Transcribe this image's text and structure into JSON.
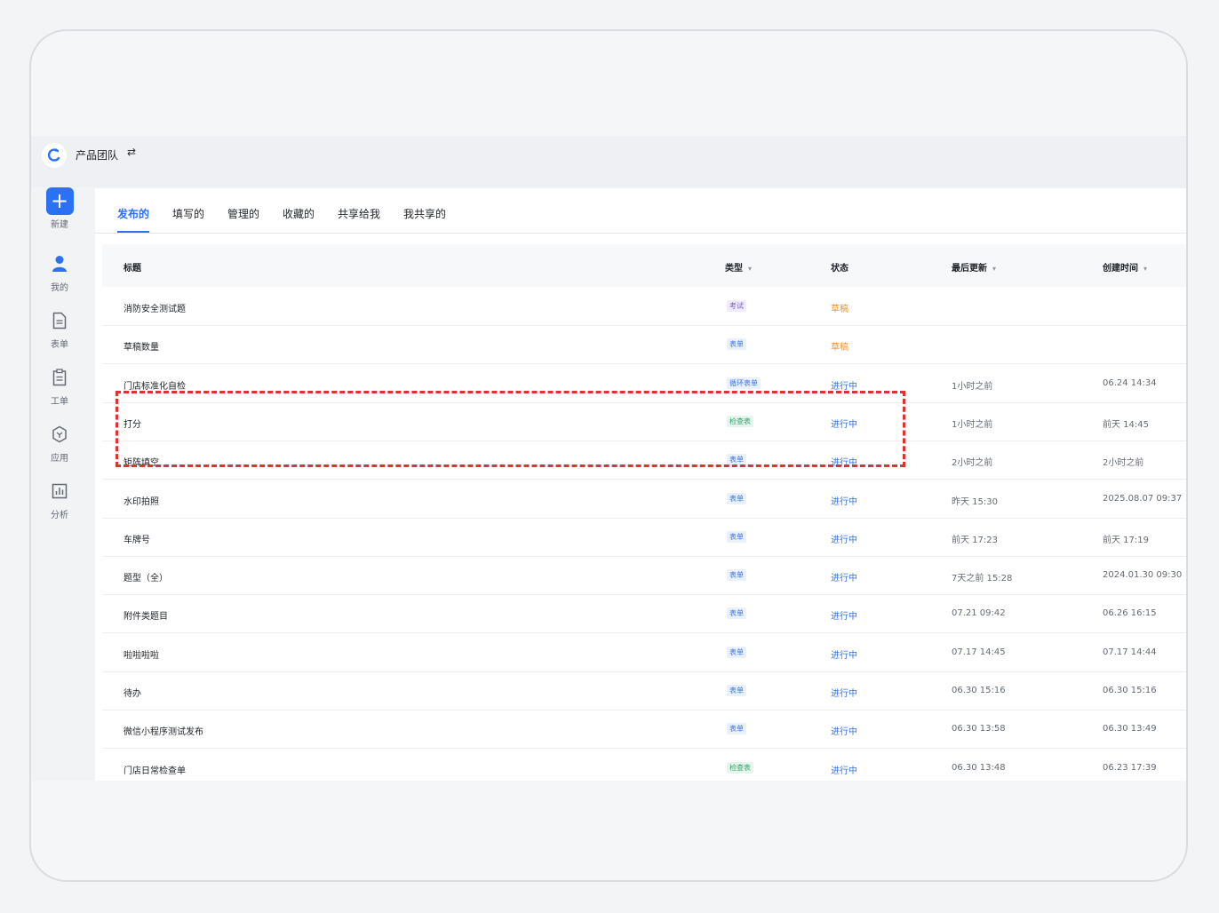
{
  "header": {
    "team_name": "产品团队",
    "switch_icon": "⇄"
  },
  "sidebar": {
    "items": [
      {
        "label": "新建",
        "icon": "plus-icon"
      },
      {
        "label": "我的",
        "icon": "user-icon"
      },
      {
        "label": "表单",
        "icon": "form-icon"
      },
      {
        "label": "工单",
        "icon": "clipboard-icon"
      },
      {
        "label": "应用",
        "icon": "app-icon"
      },
      {
        "label": "分析",
        "icon": "chart-icon"
      }
    ]
  },
  "tabs": [
    {
      "label": "发布的",
      "active": true
    },
    {
      "label": "填写的"
    },
    {
      "label": "管理的"
    },
    {
      "label": "收藏的"
    },
    {
      "label": "共享给我"
    },
    {
      "label": "我共享的"
    }
  ],
  "table": {
    "headers": {
      "title": "标题",
      "type": "类型",
      "status": "状态",
      "updated": "最后更新",
      "created": "创建时间"
    },
    "rows": [
      {
        "title": "消防安全测试题",
        "type": "考试",
        "status": "草稿",
        "updated": "",
        "created": ""
      },
      {
        "title": "草稿数量",
        "type": "表单",
        "status": "草稿",
        "updated": "",
        "created": ""
      },
      {
        "title": "门店标准化自检",
        "type": "循环表单",
        "status": "进行中",
        "updated": "1小时之前",
        "created": "06.24 14:34"
      },
      {
        "title": "打分",
        "type": "检查表",
        "status": "进行中",
        "updated": "1小时之前",
        "created": "前天 14:45"
      },
      {
        "title": "矩阵填空",
        "type": "表单",
        "status": "进行中",
        "updated": "2小时之前",
        "created": "2小时之前"
      },
      {
        "title": "水印拍照",
        "type": "表单",
        "status": "进行中",
        "updated": "昨天 15:30",
        "created": "2025.08.07 09:37"
      },
      {
        "title": "车牌号",
        "type": "表单",
        "status": "进行中",
        "updated": "前天 17:23",
        "created": "前天 17:19"
      },
      {
        "title": "题型（全）",
        "type": "表单",
        "status": "进行中",
        "updated": "7天之前 15:28",
        "created": "2024.01.30 09:30"
      },
      {
        "title": "附件类题目",
        "type": "表单",
        "status": "进行中",
        "updated": "07.21 09:42",
        "created": "06.26 16:15"
      },
      {
        "title": "啦啦啦啦",
        "type": "表单",
        "status": "进行中",
        "updated": "07.17 14:45",
        "created": "07.17 14:44"
      },
      {
        "title": "待办",
        "type": "表单",
        "status": "进行中",
        "updated": "06.30 15:16",
        "created": "06.30 15:16"
      },
      {
        "title": "微信小程序测试发布",
        "type": "表单",
        "status": "进行中",
        "updated": "06.30 13:58",
        "created": "06.30 13:49"
      },
      {
        "title": "门店日常检查单",
        "type": "检查表",
        "status": "进行中",
        "updated": "06.30 13:48",
        "created": "06.23 17:39"
      }
    ]
  },
  "colors": {
    "accent": "#2a72f3",
    "draft": "#f5902d",
    "active": "#3674e8",
    "highlight_border": "#e0302f",
    "badge_exam": "#7a5cc8",
    "badge_form": "#3674e8",
    "badge_checklist": "#2ea46a"
  }
}
